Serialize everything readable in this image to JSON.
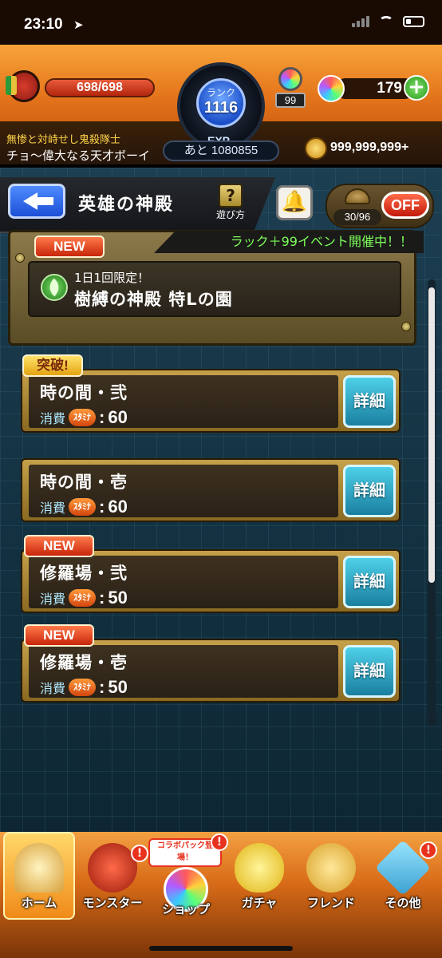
{
  "status": {
    "time": "23:10",
    "location_icon": "location-arrow-icon"
  },
  "header": {
    "hp": "698/698",
    "rank_label": "ランク",
    "rank": "1116",
    "exp_label": "EXP",
    "exp_remaining": "あと 1080855",
    "stone_count": "99",
    "orb_count": "179",
    "plus_label": "+",
    "title": "無惨と対峙せし鬼殺隊士",
    "player_name": "チョ〜偉大なる天才ボーイ",
    "coins": "999,999,999+"
  },
  "nav": {
    "title": "英雄の神殿",
    "help_glyph": "?",
    "help_label": "遊び方",
    "bell_glyph": "🔔",
    "turtle_count": "30/96",
    "off_label": "OFF"
  },
  "featured": {
    "badge": "NEW",
    "event_banner": "ラック＋99イベント開催中！！",
    "limited": "1日1回限定！",
    "title": "樹縛の神殿 特Lの園"
  },
  "quests": [
    {
      "badge": "突破!",
      "name": "時の間・弐",
      "cost_label": "消費",
      "stamina_label": "ｽﾀﾐﾅ",
      "colon": ":",
      "cost": "60",
      "detail_label": "詳細"
    },
    {
      "badge": "",
      "name": "時の間・壱",
      "cost_label": "消費",
      "stamina_label": "ｽﾀﾐﾅ",
      "colon": ":",
      "cost": "60",
      "detail_label": "詳細"
    },
    {
      "badge": "NEW",
      "name": "修羅場・弐",
      "cost_label": "消費",
      "stamina_label": "ｽﾀﾐﾅ",
      "colon": ":",
      "cost": "50",
      "detail_label": "詳細"
    },
    {
      "badge": "NEW",
      "name": "修羅場・壱",
      "cost_label": "消費",
      "stamina_label": "ｽﾀﾐﾅ",
      "colon": ":",
      "cost": "50",
      "detail_label": "詳細"
    }
  ],
  "tabs": [
    {
      "label": "ホーム",
      "icon": "home-gate-icon"
    },
    {
      "label": "モンスター",
      "icon": "monster-icon",
      "alert": "!"
    },
    {
      "label": "ショップ",
      "icon": "shop-orb-icon",
      "alert": "!",
      "tag": "コラボパック登場！"
    },
    {
      "label": "ガチャ",
      "icon": "gacha-egg-icon"
    },
    {
      "label": "フレンド",
      "icon": "friend-icon"
    },
    {
      "label": "その他",
      "icon": "other-icon",
      "alert": "!"
    }
  ],
  "colors": {
    "accent_orange": "#e4741b",
    "detail_blue": "#1a7fa0",
    "event_green": "#7dff5a"
  }
}
